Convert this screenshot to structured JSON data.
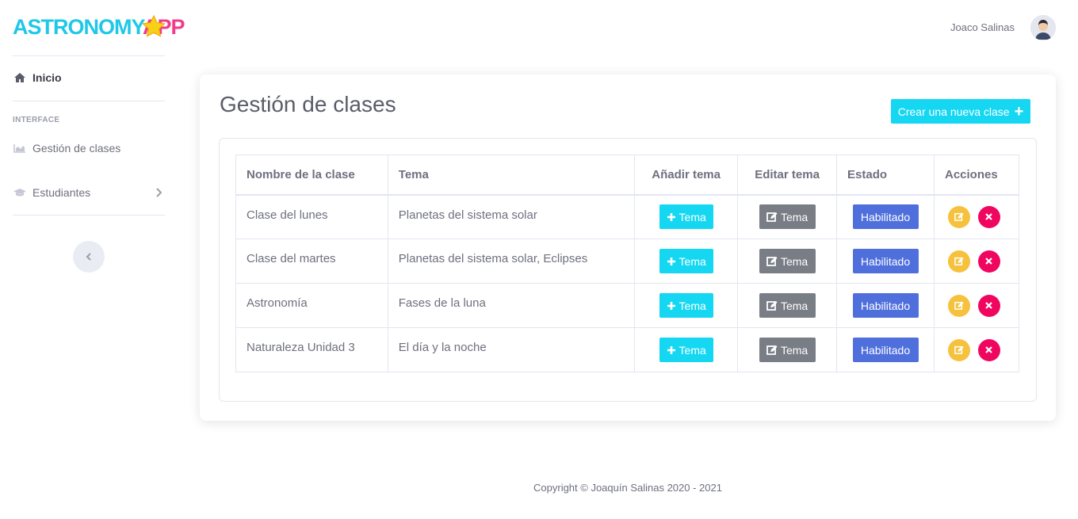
{
  "brand": {
    "logo_text_1": "ASTRONOMY",
    "logo_text_2": "APP"
  },
  "sidebar": {
    "home_label": "Inicio",
    "heading": "INTERFACE",
    "items": [
      {
        "label": "Gestión de clases",
        "icon": "chart-area-icon"
      },
      {
        "label": "Estudiantes",
        "icon": "graduation-cap-icon"
      }
    ]
  },
  "topbar": {
    "user_name": "Joaco Salinas"
  },
  "main": {
    "title": "Gestión de clases",
    "create_button": "Crear una nueva clase",
    "table": {
      "headers": [
        "Nombre de la clase",
        "Tema",
        "Añadir tema",
        "Editar tema",
        "Estado",
        "Acciones"
      ],
      "add_label": "Tema",
      "edit_label": "Tema",
      "rows": [
        {
          "name": "Clase del lunes",
          "topic": "Planetas del sistema solar",
          "status": "Habilitado"
        },
        {
          "name": "Clase del martes",
          "topic": "Planetas del sistema solar, Eclipses",
          "status": "Habilitado"
        },
        {
          "name": "Astronomía",
          "topic": "Fases de la luna",
          "status": "Habilitado"
        },
        {
          "name": "Naturaleza Unidad 3",
          "topic": "El día y la noche",
          "status": "Habilitado"
        }
      ]
    }
  },
  "footer": {
    "copyright": "Copyright © Joaquín Salinas 2020 - 2021"
  },
  "colors": {
    "cyan": "#16d7f2",
    "gray": "#797d86",
    "blue": "#4f6fdc",
    "yellow": "#f6c23e",
    "pink": "#f0065f"
  }
}
